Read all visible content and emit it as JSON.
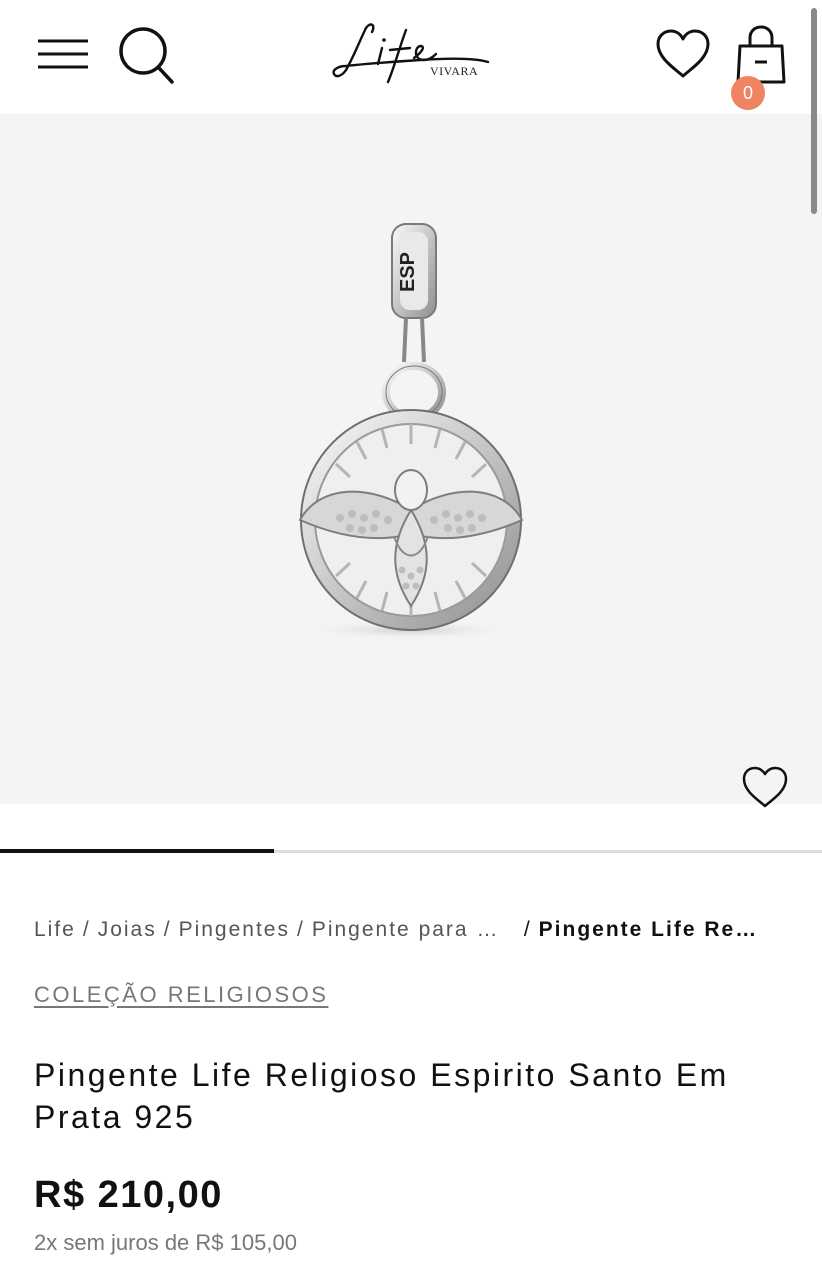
{
  "header": {
    "logo_script": "Life",
    "logo_brand": "VIVARA",
    "cart_count": "0",
    "cart_badge_color": "#ee8461",
    "icons": [
      "menu-icon",
      "search-icon",
      "heart-icon",
      "shopping-bag-icon"
    ]
  },
  "gallery": {
    "image_alt": "Pingente Life Religioso Espirito Santo Em Prata 925",
    "engraving": "ESP",
    "favorite_icon": "heart-icon",
    "slide_progress": 0.333
  },
  "breadcrumb": {
    "items": [
      "Life",
      "Joias",
      "Pingentes",
      "Pingente para P…"
    ],
    "current": "Pingente Life Reli…",
    "separator": "/"
  },
  "product": {
    "collection": "COLEÇÃO RELIGIOSOS",
    "title": "Pingente Life Religioso Espirito Santo Em Prata 925",
    "price": "R$ 210,00",
    "installments": "2x sem juros de R$ 105,00"
  }
}
